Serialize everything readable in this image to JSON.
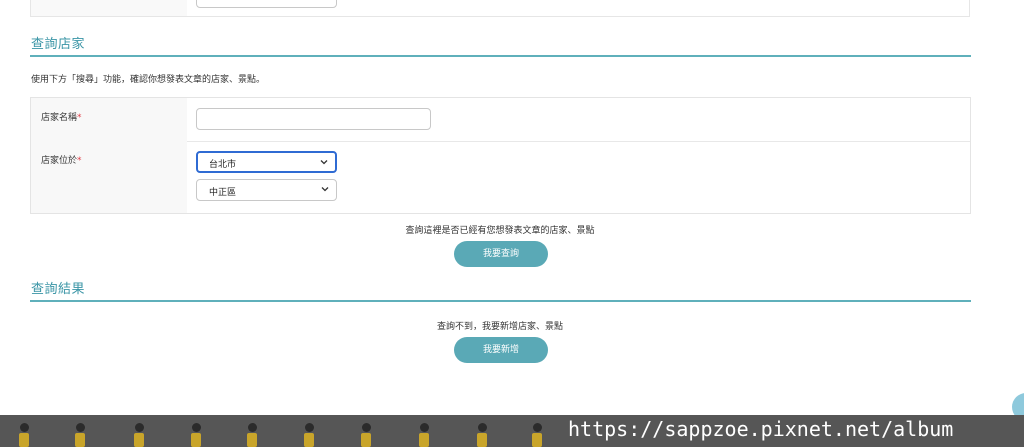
{
  "sections": {
    "search_title": "查詢店家",
    "search_desc": "使用下方「搜尋」功能，確認你想發表文章的店家、景點。",
    "result_title": "查詢結果"
  },
  "form": {
    "store_name_label": "店家名稱",
    "store_location_label": "店家位於",
    "required_mark": "*",
    "store_name_value": "",
    "city_select": "台北市",
    "district_select": "中正區"
  },
  "search_note": "查詢這裡是否已經有您想發表文章的店家、景點",
  "search_button": "我要查詢",
  "result_note": "查詢不到，我要新增店家、景點",
  "add_button": "我要新增",
  "watermark": "https://sappzoe.pixnet.net/album",
  "colors": {
    "accent": "#3a95a6",
    "button": "#5aa9b6",
    "required": "#e0404a",
    "focus": "#2f6bd3",
    "footer": "#565656"
  }
}
